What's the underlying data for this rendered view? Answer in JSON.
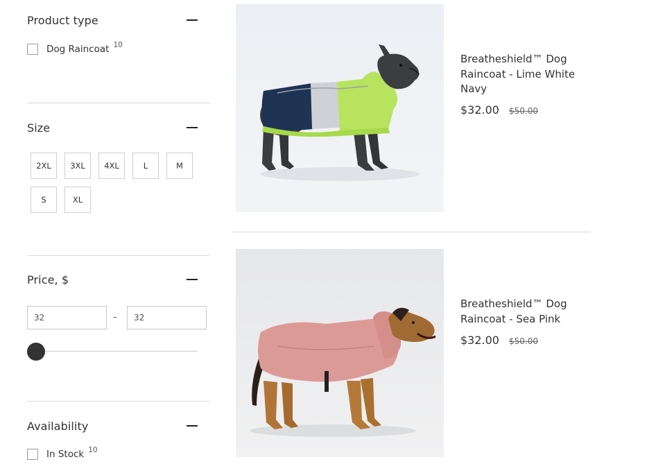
{
  "filters": {
    "product_type": {
      "title": "Product type",
      "options": [
        {
          "label": "Dog Raincoat",
          "count": "10"
        }
      ]
    },
    "size": {
      "title": "Size",
      "options": [
        "2XL",
        "3XL",
        "4XL",
        "L",
        "M",
        "S",
        "XL"
      ]
    },
    "price": {
      "title": "Price, $",
      "min_value": "32",
      "max_value": "32",
      "separator": "–",
      "slider_fraction": 0
    },
    "availability": {
      "title": "Availability",
      "options": [
        {
          "label": "In Stock",
          "count": "10"
        }
      ]
    }
  },
  "products": [
    {
      "name": "Breatheshield™ Dog Raincoat - Lime White Navy",
      "price": "$32.00",
      "compare_price": "$50.00",
      "image": "french bulldog wearing lime, white and navy raincoat"
    },
    {
      "name": "Breatheshield™ Dog Raincoat - Sea Pink",
      "price": "$32.00",
      "compare_price": "$50.00",
      "image": "large dog wearing pink raincoat"
    }
  ],
  "colors": {
    "text": "#333333",
    "divider": "#d9d9d9",
    "slider_thumb": "#333333",
    "coat_lime": "#b7e35f",
    "coat_navy": "#1f3354",
    "coat_pink": "#dc9a96"
  }
}
